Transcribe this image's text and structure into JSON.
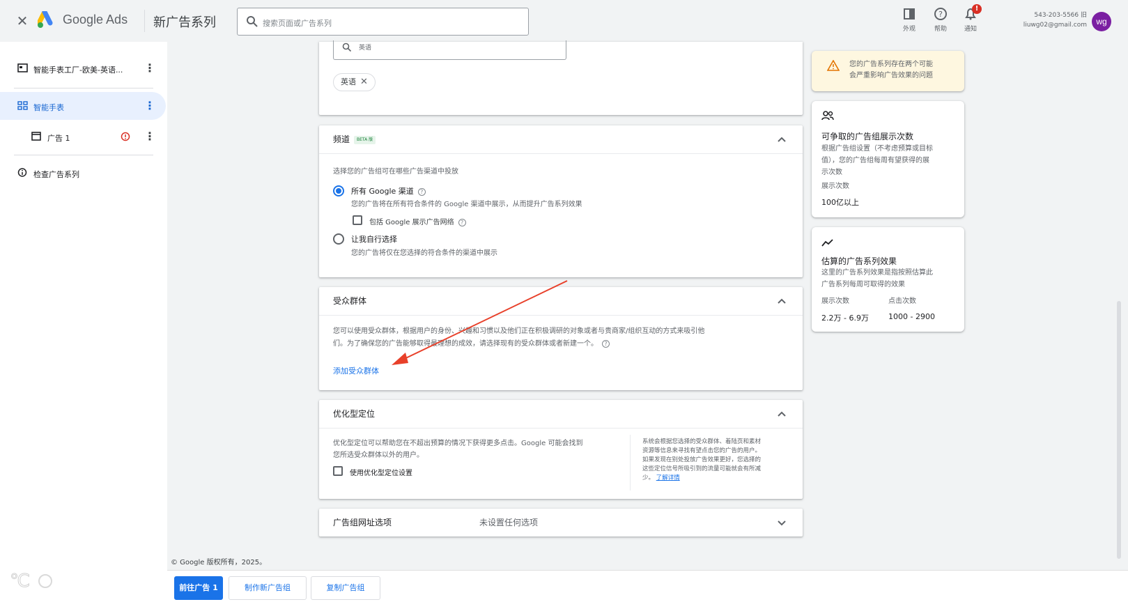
{
  "topbar": {
    "brand": "Google Ads",
    "title": "新广告系列",
    "search_placeholder": "搜索页面或广告系列",
    "actions": [
      {
        "label": "外观",
        "icon": "appearance-icon"
      },
      {
        "label": "帮助",
        "icon": "help-icon"
      },
      {
        "label": "通知",
        "icon": "bell-icon",
        "badge": "!"
      }
    ],
    "account_line1": "543-203-5566 旧",
    "account_line2": "liuwg02@gmail.com",
    "avatar": "wg"
  },
  "sidebar": {
    "campaign": "智能手表工厂-欧美-英语...",
    "ad_group": "智能手表",
    "ad": "广告 1",
    "review": "检查广告系列"
  },
  "language_card": {
    "search_value": "英语",
    "chip": "英语"
  },
  "channels": {
    "title": "频道",
    "beta": "BETA 版",
    "description": "选择您的广告组可在哪些广告渠道中投放",
    "option1_label": "所有 Google 渠道",
    "option1_desc": "您的广告将在所有符合条件的 Google 渠道中展示，从而提升广告系列效果",
    "include_display": "包括 Google 展示广告网络",
    "option2_label": "让我自行选择",
    "option2_desc": "您的广告将仅在您选择的符合条件的渠道中展示"
  },
  "audience": {
    "title": "受众群体",
    "description_line1": "您可以使用受众群体，根据用户的身份、兴趣和习惯以及他们正在积极调研的对象或者与贵商家/组织互动的方式来吸引他",
    "description_line2": "们。为了确保您的广告能够取得最理想的成效，请选择现有的受众群体或者新建一个。",
    "add_link": "添加受众群体"
  },
  "optimized": {
    "title": "优化型定位",
    "desc_line1": "优化型定位可以帮助您在不超出预算的情况下获得更多点击。Google 可能会找到",
    "desc_line2": "您所选受众群体以外的用户。",
    "checkbox": "使用优化型定位设置",
    "side_line1": "系统会根据您选择的受众群体、着陆页和素材",
    "side_line2": "资源等信息来寻找有望点击您的广告的用户。",
    "side_line3": "如果发现在别处投放广告效果更好，您选择的",
    "side_line4": "这些定位信号所吸引到的流量可能就会有所减",
    "side_line5": "少。",
    "side_link": "了解详情"
  },
  "url_options": {
    "title": "广告组网址选项",
    "value": "未设置任何选项"
  },
  "right_panel": {
    "warning_line1": "您的广告系列存在两个可能",
    "warning_line2": "会严重影响广告效果的问题",
    "impr_title": "可争取的广告组展示次数",
    "impr_desc1": "根据广告组设置（不考虑预算或目标",
    "impr_desc2": "值），您的广告组每周有望获得的展",
    "impr_desc3": "示次数",
    "impr_label": "展示次数",
    "impr_value": "100亿以上",
    "est_title": "估算的广告系列效果",
    "est_desc1": "这里的广告系列效果是指按照估算此",
    "est_desc2": "广告系列每周可取得的效果",
    "est_impr_label": "展示次数",
    "est_impr_value": "2.2万 - 6.9万",
    "est_click_label": "点击次数",
    "est_click_value": "1000 - 2900"
  },
  "footer": {
    "copyright": "© Google 版权所有，2025。",
    "btn_next": "前往广告 1",
    "btn_new_group": "制作新广告组",
    "btn_copy_group": "复制广告组"
  },
  "colors": {
    "primary": "#1a73e8",
    "error": "#d93025",
    "warning_bg": "#fef7e0",
    "annotation_arrow": "#e8402a"
  }
}
